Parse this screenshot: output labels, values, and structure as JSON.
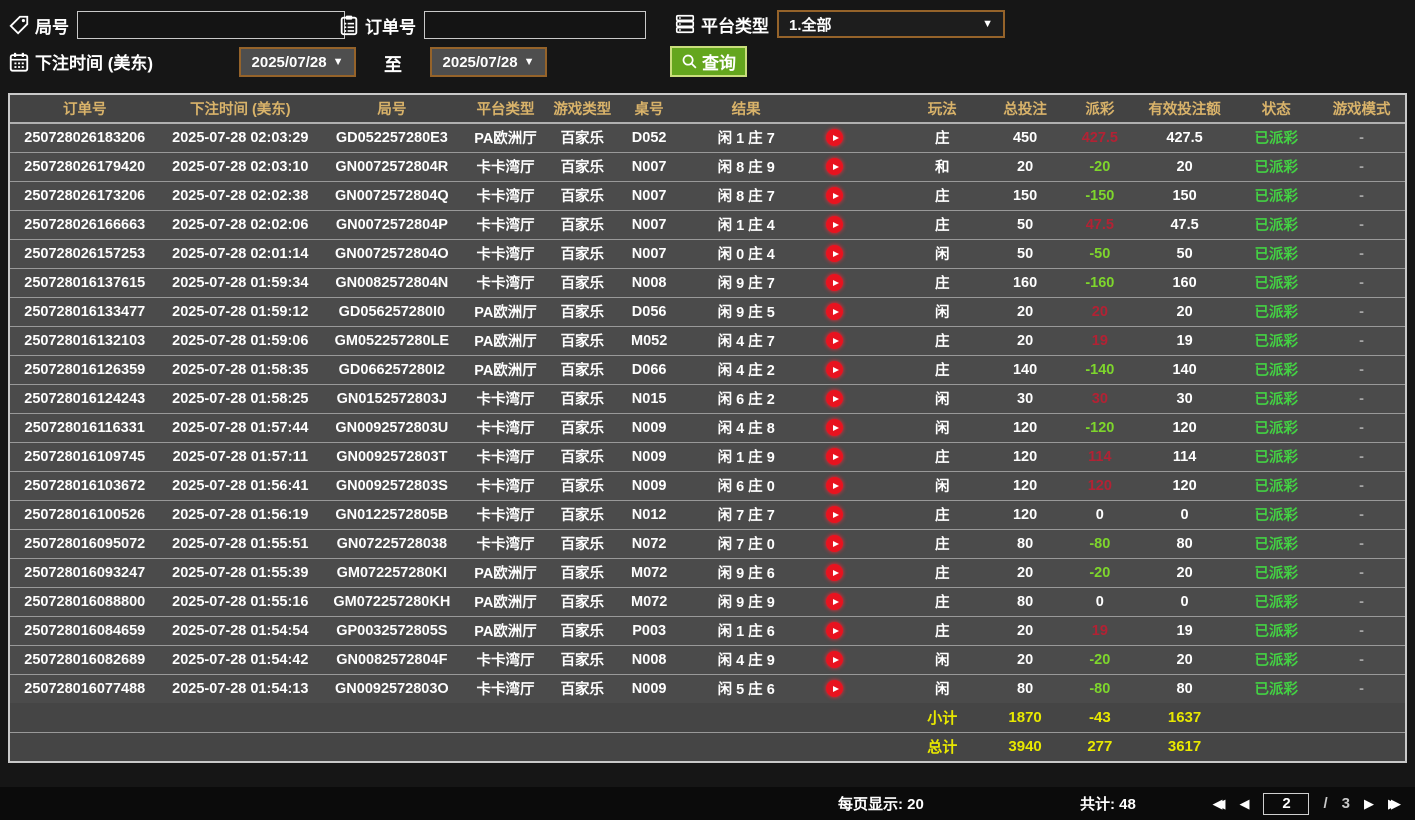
{
  "filters": {
    "game_no_label": "局号",
    "order_no_label": "订单号",
    "platform_type_label": "平台类型",
    "platform_type_value": "1.全部",
    "bet_time_label": "下注时间 (美东)",
    "date_from": "2025/07/28",
    "date_to": "2025/07/28",
    "to_label": "至",
    "search_label": "查询"
  },
  "table": {
    "columns": [
      "订单号",
      "下注时间 (美东)",
      "局号",
      "平台类型",
      "游戏类型",
      "桌号",
      "结果",
      "玩法",
      "总投注",
      "派彩",
      "有效投注额",
      "状态",
      "游戏模式"
    ],
    "rows": [
      {
        "order_id": "250728026183206",
        "bet_time": "2025-07-28 02:03:29",
        "game_no": "GD052257280E3",
        "platform": "PA欧洲厅",
        "game_type": "百家乐",
        "table_no": "D052",
        "result": "闲 1 庄 7",
        "play": "庄",
        "total_bet": "450",
        "payout": "427.5",
        "valid_bet": "427.5",
        "status": "已派彩",
        "game_mode": "-"
      },
      {
        "order_id": "250728026179420",
        "bet_time": "2025-07-28 02:03:10",
        "game_no": "GN0072572804R",
        "platform": "卡卡湾厅",
        "game_type": "百家乐",
        "table_no": "N007",
        "result": "闲 8 庄 9",
        "play": "和",
        "total_bet": "20",
        "payout": "-20",
        "valid_bet": "20",
        "status": "已派彩",
        "game_mode": "-"
      },
      {
        "order_id": "250728026173206",
        "bet_time": "2025-07-28 02:02:38",
        "game_no": "GN0072572804Q",
        "platform": "卡卡湾厅",
        "game_type": "百家乐",
        "table_no": "N007",
        "result": "闲 8 庄 7",
        "play": "庄",
        "total_bet": "150",
        "payout": "-150",
        "valid_bet": "150",
        "status": "已派彩",
        "game_mode": "-"
      },
      {
        "order_id": "250728026166663",
        "bet_time": "2025-07-28 02:02:06",
        "game_no": "GN0072572804P",
        "platform": "卡卡湾厅",
        "game_type": "百家乐",
        "table_no": "N007",
        "result": "闲 1 庄 4",
        "play": "庄",
        "total_bet": "50",
        "payout": "47.5",
        "valid_bet": "47.5",
        "status": "已派彩",
        "game_mode": "-"
      },
      {
        "order_id": "250728026157253",
        "bet_time": "2025-07-28 02:01:14",
        "game_no": "GN0072572804O",
        "platform": "卡卡湾厅",
        "game_type": "百家乐",
        "table_no": "N007",
        "result": "闲 0 庄 4",
        "play": "闲",
        "total_bet": "50",
        "payout": "-50",
        "valid_bet": "50",
        "status": "已派彩",
        "game_mode": "-"
      },
      {
        "order_id": "250728016137615",
        "bet_time": "2025-07-28 01:59:34",
        "game_no": "GN0082572804N",
        "platform": "卡卡湾厅",
        "game_type": "百家乐",
        "table_no": "N008",
        "result": "闲 9 庄 7",
        "play": "庄",
        "total_bet": "160",
        "payout": "-160",
        "valid_bet": "160",
        "status": "已派彩",
        "game_mode": "-"
      },
      {
        "order_id": "250728016133477",
        "bet_time": "2025-07-28 01:59:12",
        "game_no": "GD056257280I0",
        "platform": "PA欧洲厅",
        "game_type": "百家乐",
        "table_no": "D056",
        "result": "闲 9 庄 5",
        "play": "闲",
        "total_bet": "20",
        "payout": "20",
        "valid_bet": "20",
        "status": "已派彩",
        "game_mode": "-"
      },
      {
        "order_id": "250728016132103",
        "bet_time": "2025-07-28 01:59:06",
        "game_no": "GM052257280LE",
        "platform": "PA欧洲厅",
        "game_type": "百家乐",
        "table_no": "M052",
        "result": "闲 4 庄 7",
        "play": "庄",
        "total_bet": "20",
        "payout": "19",
        "valid_bet": "19",
        "status": "已派彩",
        "game_mode": "-"
      },
      {
        "order_id": "250728016126359",
        "bet_time": "2025-07-28 01:58:35",
        "game_no": "GD066257280I2",
        "platform": "PA欧洲厅",
        "game_type": "百家乐",
        "table_no": "D066",
        "result": "闲 4 庄 2",
        "play": "庄",
        "total_bet": "140",
        "payout": "-140",
        "valid_bet": "140",
        "status": "已派彩",
        "game_mode": "-"
      },
      {
        "order_id": "250728016124243",
        "bet_time": "2025-07-28 01:58:25",
        "game_no": "GN0152572803J",
        "platform": "卡卡湾厅",
        "game_type": "百家乐",
        "table_no": "N015",
        "result": "闲 6 庄 2",
        "play": "闲",
        "total_bet": "30",
        "payout": "30",
        "valid_bet": "30",
        "status": "已派彩",
        "game_mode": "-"
      },
      {
        "order_id": "250728016116331",
        "bet_time": "2025-07-28 01:57:44",
        "game_no": "GN0092572803U",
        "platform": "卡卡湾厅",
        "game_type": "百家乐",
        "table_no": "N009",
        "result": "闲 4 庄 8",
        "play": "闲",
        "total_bet": "120",
        "payout": "-120",
        "valid_bet": "120",
        "status": "已派彩",
        "game_mode": "-"
      },
      {
        "order_id": "250728016109745",
        "bet_time": "2025-07-28 01:57:11",
        "game_no": "GN0092572803T",
        "platform": "卡卡湾厅",
        "game_type": "百家乐",
        "table_no": "N009",
        "result": "闲 1 庄 9",
        "play": "庄",
        "total_bet": "120",
        "payout": "114",
        "valid_bet": "114",
        "status": "已派彩",
        "game_mode": "-"
      },
      {
        "order_id": "250728016103672",
        "bet_time": "2025-07-28 01:56:41",
        "game_no": "GN0092572803S",
        "platform": "卡卡湾厅",
        "game_type": "百家乐",
        "table_no": "N009",
        "result": "闲 6 庄 0",
        "play": "闲",
        "total_bet": "120",
        "payout": "120",
        "valid_bet": "120",
        "status": "已派彩",
        "game_mode": "-"
      },
      {
        "order_id": "250728016100526",
        "bet_time": "2025-07-28 01:56:19",
        "game_no": "GN0122572805B",
        "platform": "卡卡湾厅",
        "game_type": "百家乐",
        "table_no": "N012",
        "result": "闲 7 庄 7",
        "play": "庄",
        "total_bet": "120",
        "payout": "0",
        "valid_bet": "0",
        "status": "已派彩",
        "game_mode": "-"
      },
      {
        "order_id": "250728016095072",
        "bet_time": "2025-07-28 01:55:51",
        "game_no": "GN07225728038",
        "platform": "卡卡湾厅",
        "game_type": "百家乐",
        "table_no": "N072",
        "result": "闲 7 庄 0",
        "play": "庄",
        "total_bet": "80",
        "payout": "-80",
        "valid_bet": "80",
        "status": "已派彩",
        "game_mode": "-"
      },
      {
        "order_id": "250728016093247",
        "bet_time": "2025-07-28 01:55:39",
        "game_no": "GM072257280KI",
        "platform": "PA欧洲厅",
        "game_type": "百家乐",
        "table_no": "M072",
        "result": "闲 9 庄 6",
        "play": "庄",
        "total_bet": "20",
        "payout": "-20",
        "valid_bet": "20",
        "status": "已派彩",
        "game_mode": "-"
      },
      {
        "order_id": "250728016088800",
        "bet_time": "2025-07-28 01:55:16",
        "game_no": "GM072257280KH",
        "platform": "PA欧洲厅",
        "game_type": "百家乐",
        "table_no": "M072",
        "result": "闲 9 庄 9",
        "play": "庄",
        "total_bet": "80",
        "payout": "0",
        "valid_bet": "0",
        "status": "已派彩",
        "game_mode": "-"
      },
      {
        "order_id": "250728016084659",
        "bet_time": "2025-07-28 01:54:54",
        "game_no": "GP0032572805S",
        "platform": "PA欧洲厅",
        "game_type": "百家乐",
        "table_no": "P003",
        "result": "闲 1 庄 6",
        "play": "庄",
        "total_bet": "20",
        "payout": "19",
        "valid_bet": "19",
        "status": "已派彩",
        "game_mode": "-"
      },
      {
        "order_id": "250728016082689",
        "bet_time": "2025-07-28 01:54:42",
        "game_no": "GN0082572804F",
        "platform": "卡卡湾厅",
        "game_type": "百家乐",
        "table_no": "N008",
        "result": "闲 4 庄 9",
        "play": "闲",
        "total_bet": "20",
        "payout": "-20",
        "valid_bet": "20",
        "status": "已派彩",
        "game_mode": "-"
      },
      {
        "order_id": "250728016077488",
        "bet_time": "2025-07-28 01:54:13",
        "game_no": "GN0092572803O",
        "platform": "卡卡湾厅",
        "game_type": "百家乐",
        "table_no": "N009",
        "result": "闲 5 庄 6",
        "play": "闲",
        "total_bet": "80",
        "payout": "-80",
        "valid_bet": "80",
        "status": "已派彩",
        "game_mode": "-"
      }
    ],
    "subtotal": {
      "label": "小计",
      "total_bet": "1870",
      "payout": "-43",
      "valid_bet": "1637"
    },
    "total": {
      "label": "总计",
      "total_bet": "3940",
      "payout": "277",
      "valid_bet": "3617"
    }
  },
  "footer": {
    "page_size_label": "每页显示: 20",
    "total_count_label": "共计: 48",
    "current_page": "2",
    "page_separator": "/",
    "total_pages": "3"
  },
  "colors": {
    "header_text": "#d9b36a",
    "payout_positive": "#b22234",
    "payout_negative": "#7ed62c",
    "status_paid": "#43d143",
    "summary_text": "#e8e800",
    "search_button": "#64a61e",
    "dropdown_border": "#95632a",
    "play_button": "#e8131f"
  }
}
